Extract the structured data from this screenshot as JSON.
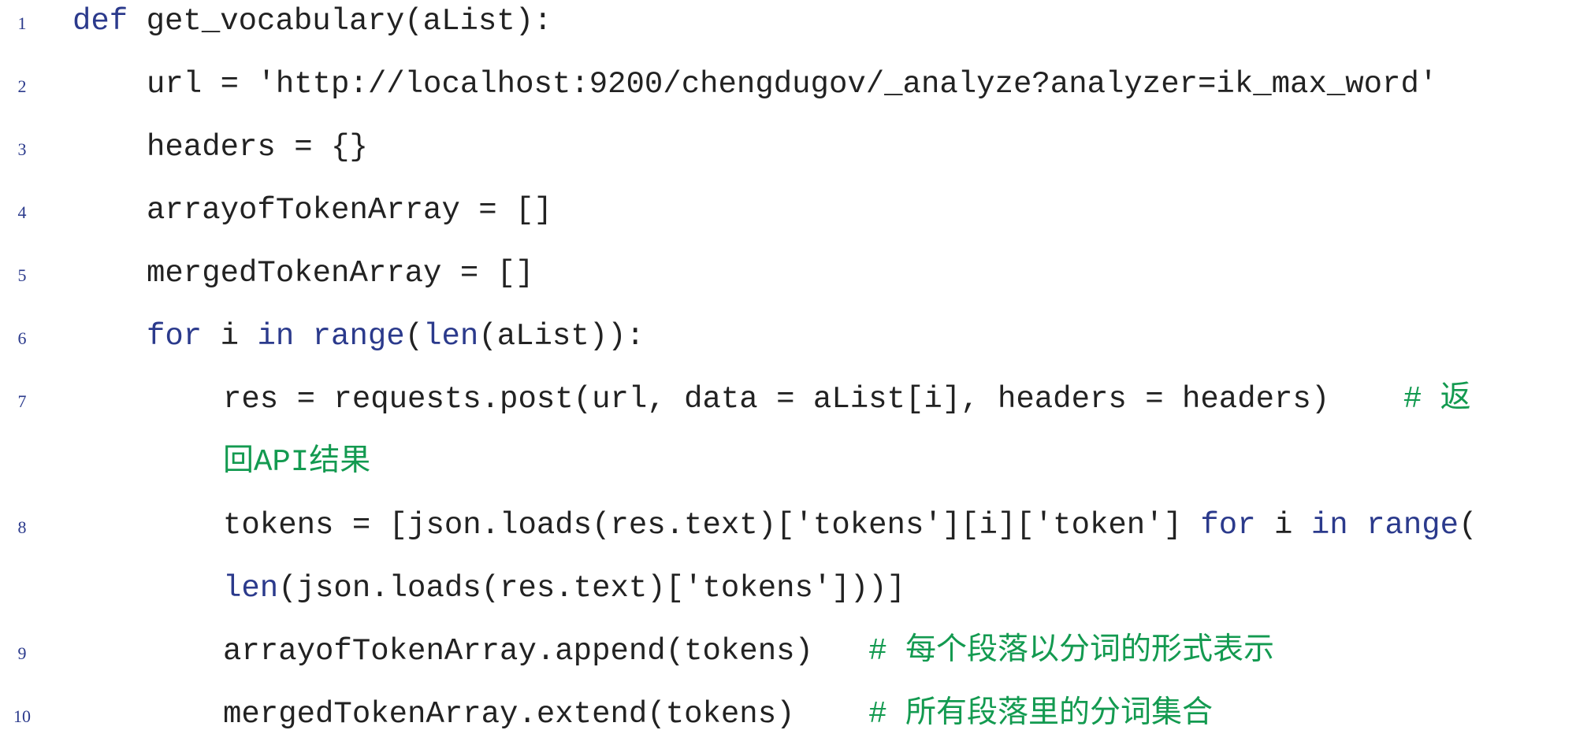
{
  "colors": {
    "keyword": "#2b3a8c",
    "comment": "#139a50",
    "text": "#222222",
    "line_number": "#2b3a8c"
  },
  "lines": [
    {
      "num": "1",
      "parts": [
        {
          "t": "def",
          "k": "kw"
        },
        {
          "t": " get_vocabulary(aList):",
          "k": "tx"
        }
      ]
    },
    {
      "num": "2",
      "parts": [
        {
          "t": "url = 'http://localhost:9200/chengdugov/_analyze?analyzer=ik_max_word'",
          "k": "tx"
        }
      ]
    },
    {
      "num": "3",
      "parts": [
        {
          "t": "headers = {}",
          "k": "tx"
        }
      ]
    },
    {
      "num": "4",
      "parts": [
        {
          "t": "arrayofTokenArray = []",
          "k": "tx"
        }
      ]
    },
    {
      "num": "5",
      "parts": [
        {
          "t": "mergedTokenArray = []",
          "k": "tx"
        }
      ]
    },
    {
      "num": "6",
      "parts": [
        {
          "t": "for",
          "k": "kw"
        },
        {
          "t": " i ",
          "k": "tx"
        },
        {
          "t": "in",
          "k": "kw"
        },
        {
          "t": " ",
          "k": "tx"
        },
        {
          "t": "range",
          "k": "kw"
        },
        {
          "t": "(",
          "k": "tx"
        },
        {
          "t": "len",
          "k": "kw"
        },
        {
          "t": "(aList)):",
          "k": "tx"
        }
      ]
    },
    {
      "num": "7",
      "parts": [
        {
          "t": "res = requests.post(url, data = aList[i], headers = headers)",
          "k": "tx"
        },
        {
          "t": "    # 返",
          "k": "cm"
        }
      ]
    },
    {
      "num": "",
      "parts": [
        {
          "t": "回API结果",
          "k": "cm"
        }
      ]
    },
    {
      "num": "8",
      "parts": [
        {
          "t": "tokens = [json.loads(res.text)['tokens'][i]['token'] ",
          "k": "tx"
        },
        {
          "t": "for",
          "k": "kw"
        },
        {
          "t": " i ",
          "k": "tx"
        },
        {
          "t": "in",
          "k": "kw"
        },
        {
          "t": " ",
          "k": "tx"
        },
        {
          "t": "range",
          "k": "kw"
        },
        {
          "t": "(",
          "k": "tx"
        }
      ]
    },
    {
      "num": "",
      "parts": [
        {
          "t": "len",
          "k": "kw"
        },
        {
          "t": "(json.loads(res.text)['tokens']))]",
          "k": "tx"
        }
      ]
    },
    {
      "num": "9",
      "parts": [
        {
          "t": "arrayofTokenArray.append(tokens)",
          "k": "tx"
        },
        {
          "t": "   # 每个段落以分词的形式表示",
          "k": "cm"
        }
      ]
    },
    {
      "num": "10",
      "parts": [
        {
          "t": "mergedTokenArray.extend(tokens)",
          "k": "tx"
        },
        {
          "t": "    # 所有段落里的分词集合",
          "k": "cm"
        }
      ]
    }
  ]
}
